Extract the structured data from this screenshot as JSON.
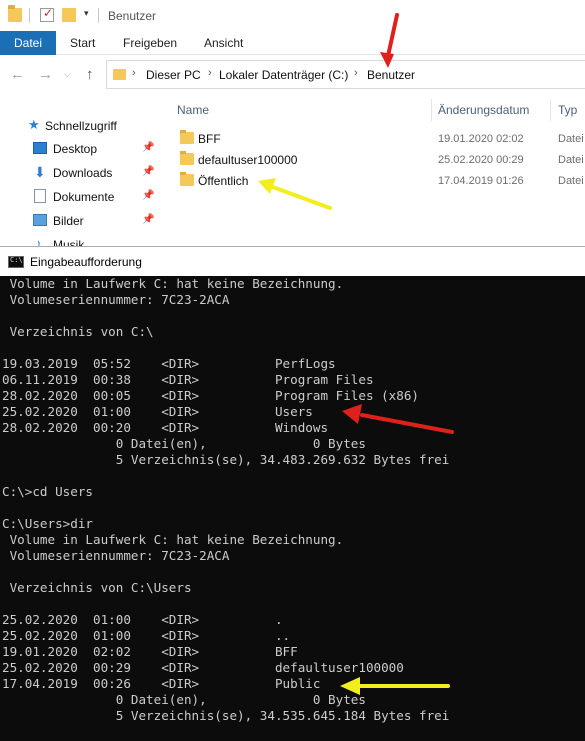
{
  "explorer": {
    "window_title": "Benutzer",
    "quick_access_dropdown": "▾",
    "ribbon_tabs": [
      "Datei",
      "Start",
      "Freigeben",
      "Ansicht"
    ],
    "nav_buttons": {
      "back": "←",
      "forward": "→",
      "recent": "⌵",
      "up": "↑"
    },
    "breadcrumb": {
      "separator": "›",
      "items": [
        "Dieser PC",
        "Lokaler Datenträger (C:)",
        "Benutzer"
      ]
    },
    "nav_pane": {
      "quick_access_label": "Schnellzugriff",
      "pin_glyph": "📌",
      "items": [
        {
          "label": "Desktop",
          "icon": "desktop-icon",
          "pinned": true
        },
        {
          "label": "Downloads",
          "icon": "downloads-icon",
          "pinned": true
        },
        {
          "label": "Dokumente",
          "icon": "documents-icon",
          "pinned": true
        },
        {
          "label": "Bilder",
          "icon": "pictures-icon",
          "pinned": true
        },
        {
          "label": "Musik",
          "icon": "music-icon",
          "pinned": false
        }
      ]
    },
    "columns": {
      "name": "Name",
      "date": "Änderungsdatum",
      "type": "Typ"
    },
    "files": [
      {
        "name": "BFF",
        "date": "19.01.2020 02:02",
        "type": "Datei"
      },
      {
        "name": "defaultuser100000",
        "date": "25.02.2020 00:29",
        "type": "Datei"
      },
      {
        "name": "Öffentlich",
        "date": "17.04.2019 01:26",
        "type": "Datei"
      }
    ]
  },
  "console": {
    "title": "Eingabeaufforderung",
    "lines": [
      " Volume in Laufwerk C: hat keine Bezeichnung.",
      " Volumeseriennummer: 7C23-2ACA",
      "",
      " Verzeichnis von C:\\",
      "",
      "19.03.2019  05:52    <DIR>          PerfLogs",
      "06.11.2019  00:38    <DIR>          Program Files",
      "28.02.2020  00:05    <DIR>          Program Files (x86)",
      "25.02.2020  01:00    <DIR>          Users",
      "28.02.2020  00:20    <DIR>          Windows",
      "               0 Datei(en),              0 Bytes",
      "               5 Verzeichnis(se), 34.483.269.632 Bytes frei",
      "",
      "C:\\>cd Users",
      "",
      "C:\\Users>dir",
      " Volume in Laufwerk C: hat keine Bezeichnung.",
      " Volumeseriennummer: 7C23-2ACA",
      "",
      " Verzeichnis von C:\\Users",
      "",
      "25.02.2020  01:00    <DIR>          .",
      "25.02.2020  01:00    <DIR>          ..",
      "19.01.2020  02:02    <DIR>          BFF",
      "25.02.2020  00:29    <DIR>          defaultuser100000",
      "17.04.2019  00:26    <DIR>          Public",
      "               0 Datei(en),              0 Bytes",
      "               5 Verzeichnis(se), 34.535.645.184 Bytes frei"
    ]
  },
  "annotations": {
    "red_color": "#e0201a",
    "yellow_color": "#f2ee1e"
  }
}
